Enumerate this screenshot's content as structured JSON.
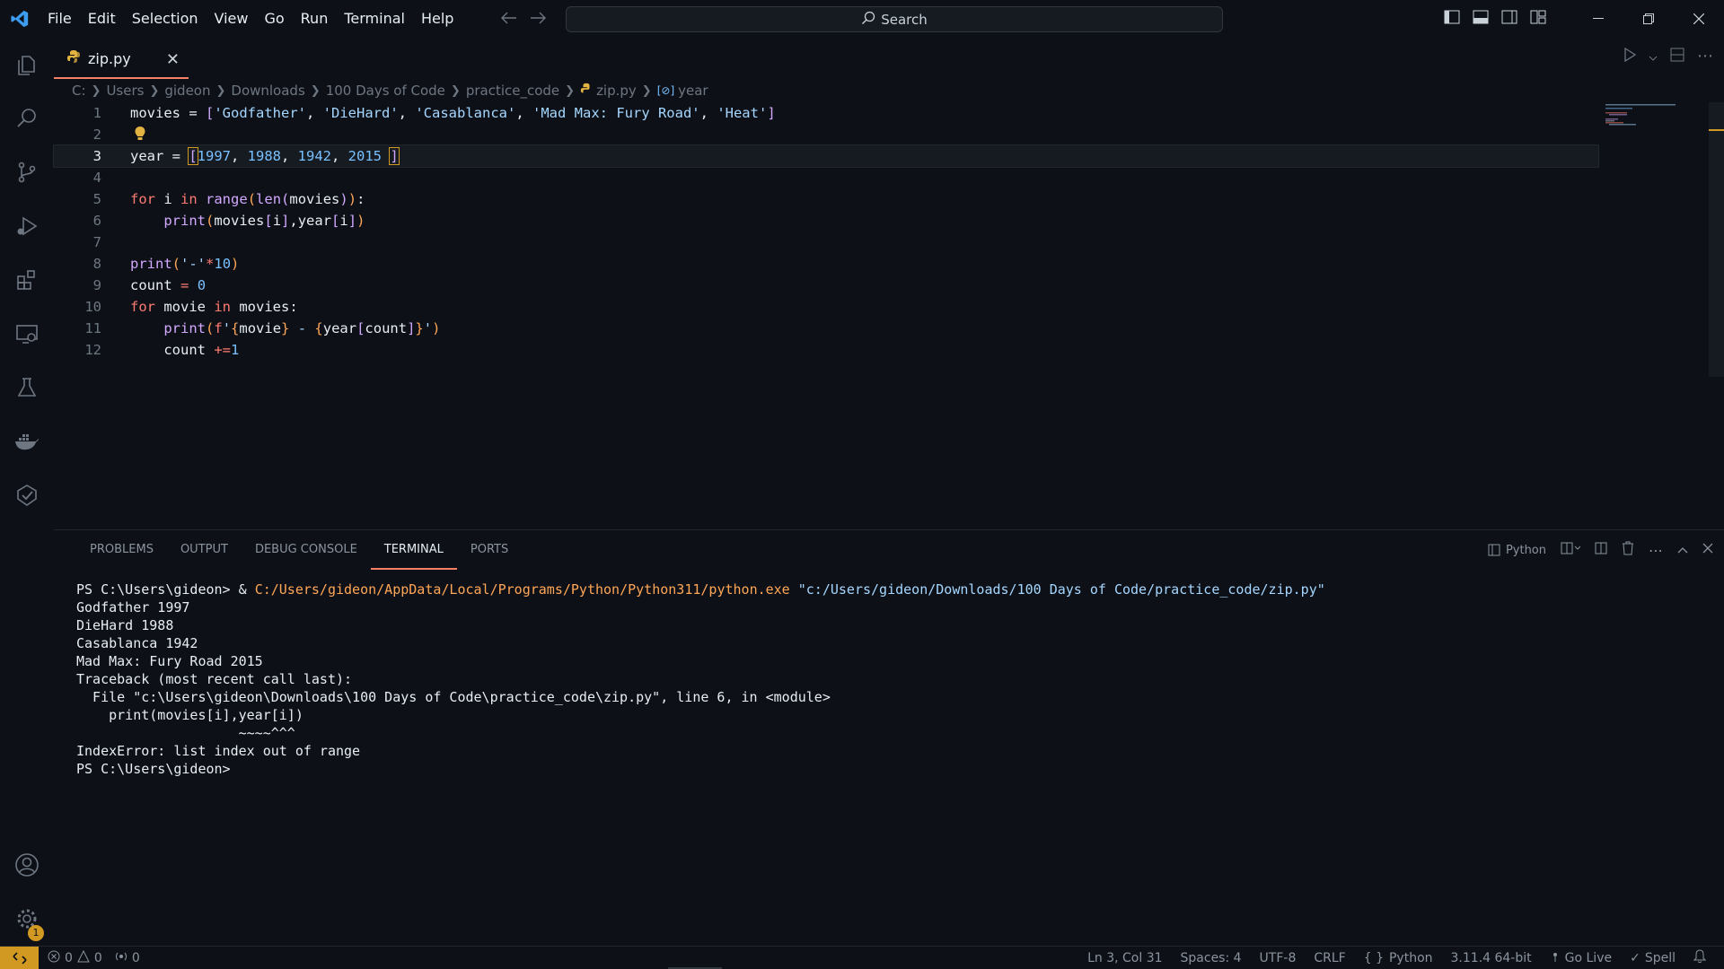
{
  "titlebar": {
    "menu": [
      "File",
      "Edit",
      "Selection",
      "View",
      "Go",
      "Run",
      "Terminal",
      "Help"
    ],
    "search_label": "Search"
  },
  "tab": {
    "label": "zip.py"
  },
  "breadcrumb": [
    "C:",
    "Users",
    "gideon",
    "Downloads",
    "100 Days of Code",
    "practice_code",
    "zip.py",
    "year"
  ],
  "editor": {
    "line_numbers": [
      "1",
      "2",
      "3",
      "4",
      "5",
      "6",
      "7",
      "8",
      "9",
      "10",
      "11",
      "12"
    ],
    "current_line": 3
  },
  "panel": {
    "tabs": [
      "PROBLEMS",
      "OUTPUT",
      "DEBUG CONSOLE",
      "TERMINAL",
      "PORTS"
    ],
    "active_tab": "TERMINAL",
    "shell_label": "Python",
    "terminal_lines": [
      {
        "prompt": "PS C:\\Users\\gideon> & ",
        "exe": "C:/Users/gideon/AppData/Local/Programs/Python/Python311/python.exe",
        "arg": " \"c:/Users/gideon/Downloads/100 Days of Code/practice_code/zip.py\""
      },
      {
        "text": "Godfather 1997"
      },
      {
        "text": "DieHard 1988"
      },
      {
        "text": "Casablanca 1942"
      },
      {
        "text": "Mad Max: Fury Road 2015"
      },
      {
        "text": "Traceback (most recent call last):"
      },
      {
        "text": "  File \"c:\\Users\\gideon\\Downloads\\100 Days of Code\\practice_code\\zip.py\", line 6, in <module>"
      },
      {
        "text": "    print(movies[i],year[i])"
      },
      {
        "text": "                    ~~~~^^^"
      },
      {
        "text": "IndexError: list index out of range"
      },
      {
        "text": "PS C:\\Users\\gideon>"
      }
    ]
  },
  "statusbar": {
    "errors": "0",
    "warnings": "0",
    "ports": "0",
    "position": "Ln 3, Col 31",
    "spaces": "Spaces: 4",
    "encoding": "UTF-8",
    "eol": "CRLF",
    "language": "Python",
    "interpreter": "3.11.4 64-bit",
    "golive": "Go Live",
    "spell": "Spell",
    "settings_badge": "1"
  },
  "colors": {
    "accent": "#f78166",
    "badge": "#d29922",
    "background": "#0d1117"
  }
}
